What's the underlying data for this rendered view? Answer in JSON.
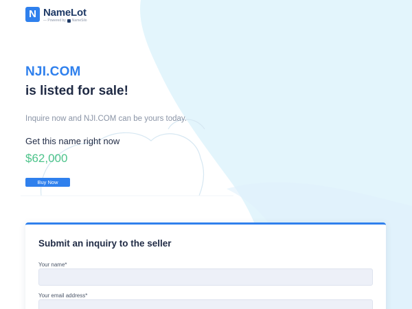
{
  "header": {
    "logo_letter": "N",
    "brand_name": "NameLot",
    "powered_by": "— Powered by",
    "powered_brand": "NameSilo"
  },
  "hero": {
    "domain": "NJI.COM",
    "tagline": "is listed for sale!",
    "inquire_text": "Inquire now and NJI.COM can be yours today.",
    "get_name_text": "Get this name right now",
    "price": "$62,000",
    "buy_button": "Buy Now"
  },
  "inquiry_form": {
    "title": "Submit an inquiry to the seller",
    "name_label": "Your name*",
    "name_value": "",
    "email_label": "Your email address*",
    "email_value": ""
  },
  "colors": {
    "accent": "#2f80ed",
    "price": "#4cc38a",
    "bg_blob": "#e3f5fc"
  },
  "icons": [
    "namelot-logo-icon",
    "namesilo-icon"
  ]
}
